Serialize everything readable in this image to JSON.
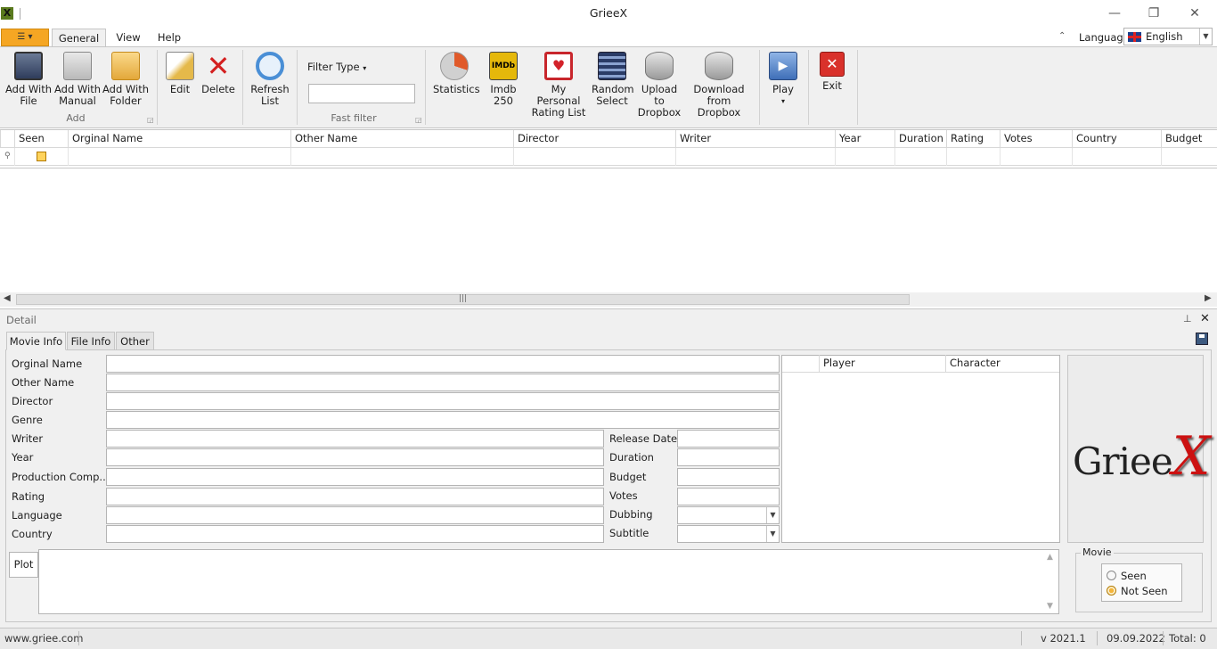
{
  "window": {
    "title": "GrieeX",
    "minimize_glyph": "—",
    "restore_glyph": "❐",
    "close_glyph": "✕"
  },
  "app_menu": {
    "icon": "app-menu-icon",
    "glyph": "☰ ▾"
  },
  "tabs": [
    {
      "label": "General"
    },
    {
      "label": "View"
    },
    {
      "label": "Help"
    }
  ],
  "language": {
    "label": "Language",
    "value": "English",
    "flag": "uk-flag-icon"
  },
  "ribbon": {
    "groups": [
      {
        "label": "Add",
        "buttons": [
          {
            "line1": "Add With",
            "line2": "File",
            "icon": "film-reel-icon"
          },
          {
            "line1": "Add With",
            "line2": "Manual",
            "icon": "manual-entry-icon"
          },
          {
            "line1": "Add With",
            "line2": "Folder",
            "icon": "folder-icon"
          }
        ]
      },
      {
        "label": "",
        "buttons": [
          {
            "line1": "Edit",
            "line2": "",
            "icon": "edit-pencil-icon"
          },
          {
            "line1": "Delete",
            "line2": "",
            "icon": "delete-x-icon"
          }
        ]
      },
      {
        "label": "",
        "buttons": [
          {
            "line1": "Refresh",
            "line2": "List",
            "icon": "refresh-icon"
          }
        ]
      },
      {
        "label": "Fast filter",
        "filter_type": "Filter Type",
        "filter_value": ""
      },
      {
        "label": "",
        "buttons": [
          {
            "line1": "Statistics",
            "line2": "",
            "icon": "pie-chart-icon"
          },
          {
            "line1": "Imdb 250",
            "line2": "",
            "icon": "imdb-icon"
          },
          {
            "line1": "My Personal",
            "line2": "Rating List",
            "icon": "heart-monitor-icon"
          },
          {
            "line1": "Random",
            "line2": "Select",
            "icon": "film-strip-icon"
          },
          {
            "line1": "Upload to",
            "line2": "Dropbox",
            "icon": "upload-database-icon"
          },
          {
            "line1": "Download",
            "line2": "from Dropbox",
            "icon": "download-database-icon"
          }
        ]
      },
      {
        "label": "",
        "buttons": [
          {
            "line1": "Play",
            "line2": "▾",
            "icon": "play-clapper-icon"
          }
        ]
      },
      {
        "label": "",
        "buttons": [
          {
            "line1": "Exit",
            "line2": "",
            "icon": "exit-icon"
          }
        ]
      }
    ]
  },
  "grid": {
    "columns": [
      "Seen",
      "Orginal Name",
      "Other Name",
      "Director",
      "Writer",
      "Year",
      "Duration",
      "Rating",
      "Votes",
      "Country",
      "Budget"
    ],
    "rows": []
  },
  "detail": {
    "title": "Detail",
    "tabs": [
      "Movie Info",
      "File Info",
      "Other"
    ],
    "fields_left": [
      "Orginal Name",
      "Other Name",
      "Director",
      "Genre",
      "Writer",
      "Year",
      "Production Comp...",
      "Rating",
      "Language",
      "Country"
    ],
    "fields_right": [
      "Release Date",
      "Duration",
      "Budget",
      "Votes",
      "Dubbing",
      "Subtitle"
    ],
    "cast_columns": [
      "Player",
      "Character"
    ],
    "logo_text": "Griee",
    "logo_x": "X",
    "plot_label": "Plot",
    "movie_group": "Movie",
    "seen_options": [
      {
        "label": "Seen",
        "selected": false
      },
      {
        "label": "Not Seen",
        "selected": true
      }
    ]
  },
  "status": {
    "website": "www.griee.com",
    "version": "v 2021.1",
    "date": "09.09.2022",
    "total": "Total: 0"
  }
}
